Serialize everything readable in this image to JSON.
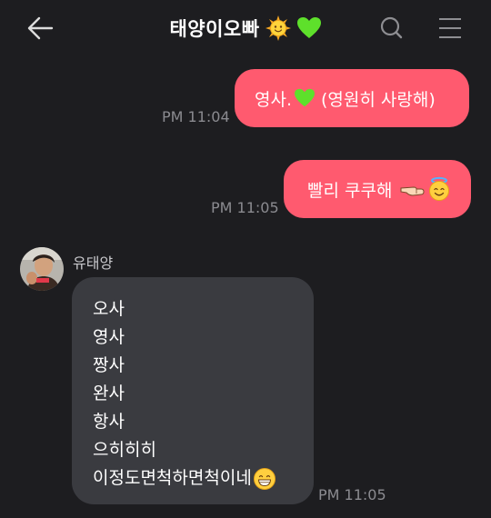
{
  "header": {
    "title": "태양이오빠",
    "title_emojis": [
      "sun-with-face",
      "green-heart"
    ]
  },
  "messages": {
    "out": [
      {
        "text": "영사.",
        "text_after": "(영원히 사랑해)",
        "time": "PM 11:04"
      },
      {
        "text": "빨리 쿠쿠해",
        "time": "PM 11:05"
      }
    ],
    "in": {
      "sender": "유태양",
      "lines": [
        "오사",
        "영사",
        "짱사",
        "완사",
        "항사",
        "으히히히",
        "이정도면척하면척이네"
      ],
      "time": "PM 11:05"
    }
  },
  "colors": {
    "background": "#1d1d20",
    "outgoing_bubble": "#ff5a6f",
    "incoming_bubble": "#3a3b40",
    "timestamp": "#8b8b90"
  }
}
